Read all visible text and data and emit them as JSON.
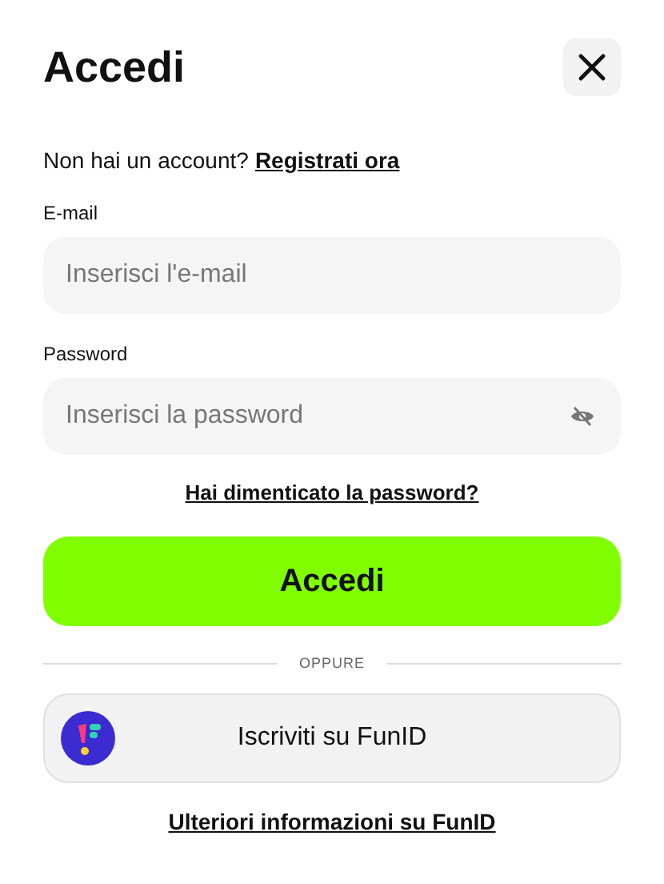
{
  "title": "Accedi",
  "signup_prompt": {
    "text": "Non hai un account?",
    "link": "Registrati ora"
  },
  "fields": [
    {
      "label": "E-mail",
      "placeholder": "Inserisci l'e-mail",
      "kind": "text"
    },
    {
      "label": "Password",
      "placeholder": "Inserisci la password",
      "kind": "password"
    }
  ],
  "forgot_link": "Hai dimenticato la password?",
  "submit_button": "Accedi",
  "divider": "OPPURE",
  "funid_button": "Iscriviti su FunID",
  "funid_link": "Ulteriori informazioni su FunID"
}
